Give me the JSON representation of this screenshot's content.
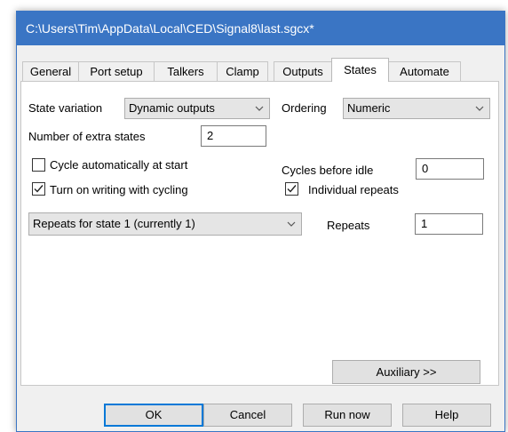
{
  "window": {
    "title": "C:\\Users\\Tim\\AppData\\Local\\CED\\Signal8\\last.sgcx*"
  },
  "tabs": [
    "General",
    "Port setup",
    "Talkers",
    "Clamp",
    "Outputs",
    "States",
    "Automate"
  ],
  "active_tab": "States",
  "states": {
    "state_variation_label": "State variation",
    "state_variation_value": "Dynamic outputs",
    "ordering_label": "Ordering",
    "ordering_value": "Numeric",
    "extra_states_label": "Number of extra states",
    "extra_states_value": "2",
    "cycle_auto_label": "Cycle automatically at start",
    "cycle_auto_checked": false,
    "cycles_before_idle_label": "Cycles before idle",
    "cycles_before_idle_value": "0",
    "writing_label": "Turn on writing with cycling",
    "writing_checked": true,
    "individual_repeats_label": "Individual repeats",
    "individual_repeats_checked": true,
    "repeats_select_value": "Repeats for state 1 (currently 1)",
    "repeats_label": "Repeats",
    "repeats_value": "1",
    "auxiliary_label": "Auxiliary >>"
  },
  "footer": {
    "ok": "OK",
    "cancel": "Cancel",
    "run_now": "Run now",
    "help": "Help"
  },
  "colors": {
    "titlebar": "#3a75c4",
    "default_button_border": "#0078d7"
  }
}
